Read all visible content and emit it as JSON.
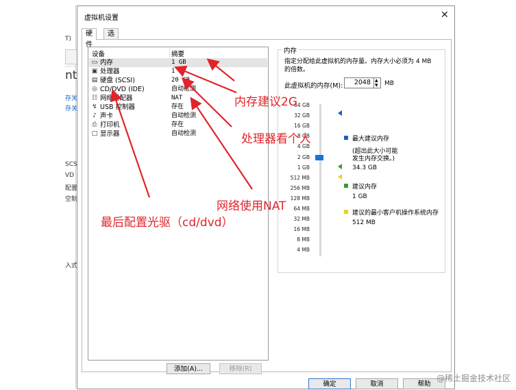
{
  "background_window": {
    "texts": [
      "T)",
      "nt",
      "存关",
      "存关",
      "SCS",
      "VD",
      "配置",
      "空制",
      "入式"
    ]
  },
  "dialog": {
    "title": "虚拟机设置",
    "close_glyph": "✕",
    "tabs": [
      {
        "label": "硬件",
        "active": true
      },
      {
        "label": "选项",
        "active": false
      }
    ],
    "device_list": {
      "col_device": "设备",
      "col_summary": "摘要",
      "rows": [
        {
          "icon": "memory-icon",
          "glyph": "▭",
          "name": "内存",
          "summary": "1 GB",
          "selected": true
        },
        {
          "icon": "cpu-icon",
          "glyph": "▣",
          "name": "处理器",
          "summary": "1",
          "selected": false
        },
        {
          "icon": "harddisk-icon",
          "glyph": "▤",
          "name": "硬盘 (SCSI)",
          "summary": "20 GB",
          "selected": false
        },
        {
          "icon": "cd-icon",
          "glyph": "◎",
          "name": "CD/DVD (IDE)",
          "summary": "自动检测",
          "selected": false
        },
        {
          "icon": "network-adapter-icon",
          "glyph": "☷",
          "name": "网络适配器",
          "summary": "NAT",
          "selected": false
        },
        {
          "icon": "usb-icon",
          "glyph": "↯",
          "name": "USB 控制器",
          "summary": "存在",
          "selected": false
        },
        {
          "icon": "sound-card-icon",
          "glyph": "♪",
          "name": "声卡",
          "summary": "自动检测",
          "selected": false
        },
        {
          "icon": "printer-icon",
          "glyph": "⎙",
          "name": "打印机",
          "summary": "存在",
          "selected": false
        },
        {
          "icon": "display-icon",
          "glyph": "□",
          "name": "显示器",
          "summary": "自动检测",
          "selected": false
        }
      ]
    },
    "add_button": "添加(A)...",
    "remove_button": "移除(R)",
    "memory": {
      "group_title": "内存",
      "description_line1": "指定分配给此虚拟机的内存量。内存大小必须为 4 MB",
      "description_line2": "的倍数。",
      "field_label": "此虚拟机的内存(M):",
      "value": "2048",
      "unit": "MB",
      "scale_labels": [
        "64 GB",
        "32 GB",
        "16 GB",
        "8 GB",
        "4 GB",
        "2 GB",
        "1 GB",
        "512 MB",
        "256 MB",
        "128 MB",
        "64 MB",
        "32 MB",
        "16 MB",
        "8 MB",
        "4 MB"
      ],
      "slider_value": "2 GB",
      "legend": {
        "max_title": "最大建议内存",
        "max_note1": "(超出此大小可能",
        "max_note2": "发生内存交换。)",
        "max_value": "34.3 GB",
        "max_color": "#1f5fb4",
        "rec_title": "建议内存",
        "rec_value": "1 GB",
        "rec_color": "#3a9a32",
        "min_title": "建议的最小客户机操作系统内存",
        "min_value": "512 MB",
        "min_color": "#e8d41a"
      }
    },
    "ok_button": "确定",
    "cancel_button": "取消",
    "help_button": "帮助"
  },
  "annotations": {
    "memory_note": "内存建议2G",
    "cpu_note": "处理器看个人",
    "network_note": "网络使用NAT",
    "cd_note": "最后配置光驱（cd/dvd）",
    "color": "#e0242a"
  },
  "watermark": "@稀土掘金技术社区"
}
